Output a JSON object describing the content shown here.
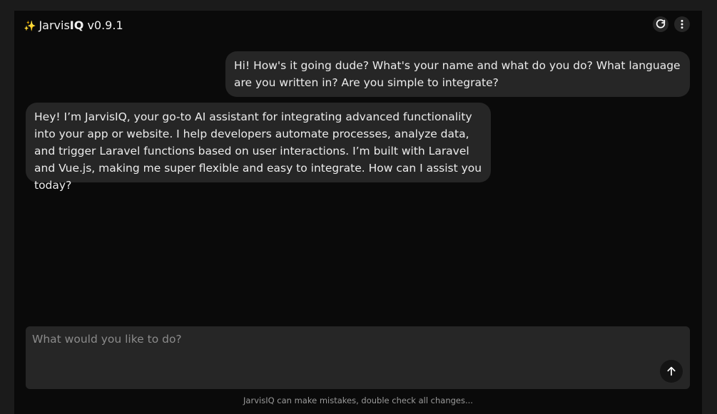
{
  "header": {
    "sparkle": "✨",
    "brand_regular": "Jarvis",
    "brand_bold": "IQ",
    "version": " v0.9.1",
    "refresh_icon": "refresh-icon",
    "menu_icon": "more-vertical-icon"
  },
  "messages": [
    {
      "role": "user",
      "text": "Hi! How's it going dude? What's your name and what do you do? What language are you written in? Are you simple to integrate?"
    },
    {
      "role": "assistant",
      "text": "Hey! I’m JarvisIQ, your go-to AI assistant for integrating advanced functionality into your app or website. I help developers automate processes, analyze data, and trigger Laravel functions based on user interactions. I’m built with Laravel and Vue.js, making me super flexible and easy to integrate. How can I assist you today?"
    }
  ],
  "composer": {
    "placeholder": "What would you like to do?",
    "value": "",
    "send_icon": "arrow-up-icon"
  },
  "footer": {
    "disclaimer": "JarvisIQ can make mistakes, double check all changes..."
  },
  "colors": {
    "background": "#0a0a0a",
    "bubble": "#262626",
    "text": "#ececec",
    "muted": "#8b8b8b"
  }
}
